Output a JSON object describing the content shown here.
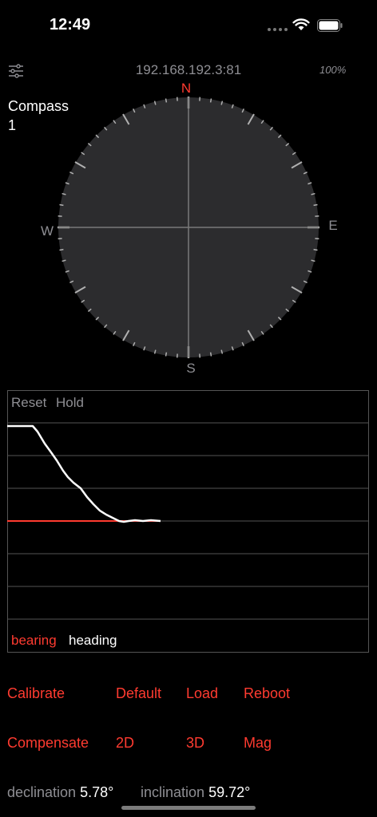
{
  "status_bar": {
    "time": "12:49"
  },
  "header": {
    "ip": "192.168.192.3:81",
    "battery": "100%"
  },
  "compass": {
    "title": "Compass",
    "index": "1",
    "north": "N",
    "east": "E",
    "south": "S",
    "west": "W",
    "needle_heading_deg": 0
  },
  "chart": {
    "reset_label": "Reset",
    "hold_label": "Hold",
    "legend": {
      "bearing": "bearing",
      "heading": "heading"
    },
    "colors": {
      "bearing": "#ff3b30",
      "heading": "#ffffff"
    }
  },
  "actions": {
    "row1": [
      "Calibrate",
      "Default",
      "Load",
      "Reboot"
    ],
    "row2": [
      "Compensate",
      "2D",
      "3D",
      "Mag"
    ]
  },
  "readouts": {
    "declination_label": "declination",
    "declination_value": "5.78°",
    "inclination_label": "inclination",
    "inclination_value": "59.72°"
  },
  "colors": {
    "accent": "#ff3b30",
    "dial": "#2c2c2e",
    "muted": "#8e8e93"
  }
}
